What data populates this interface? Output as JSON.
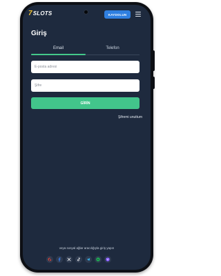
{
  "app": {
    "logo_number": "7",
    "logo_text": "SLOTS",
    "signup_label": "KAYDOLUN"
  },
  "login": {
    "title": "Giriş",
    "tabs": [
      {
        "label": "Email",
        "active": true
      },
      {
        "label": "Telefon",
        "active": false
      }
    ],
    "email_placeholder": "E-posta adresi",
    "password_placeholder": "Şifre",
    "submit_label": "GİRİN",
    "forgot_label": "Şifremi unuttum"
  },
  "social": {
    "text": "veya sosyal ağlar aracılığıyla giriş yapın",
    "icons": [
      "google-icon",
      "facebook-icon",
      "x-icon",
      "tiktok-icon",
      "telegram-icon",
      "spotify-icon",
      "yahoo-icon"
    ]
  },
  "colors": {
    "screen_bg": "#1e2a3e",
    "accent_green": "#42c58b",
    "signup_blue": "#2f7fe0"
  }
}
